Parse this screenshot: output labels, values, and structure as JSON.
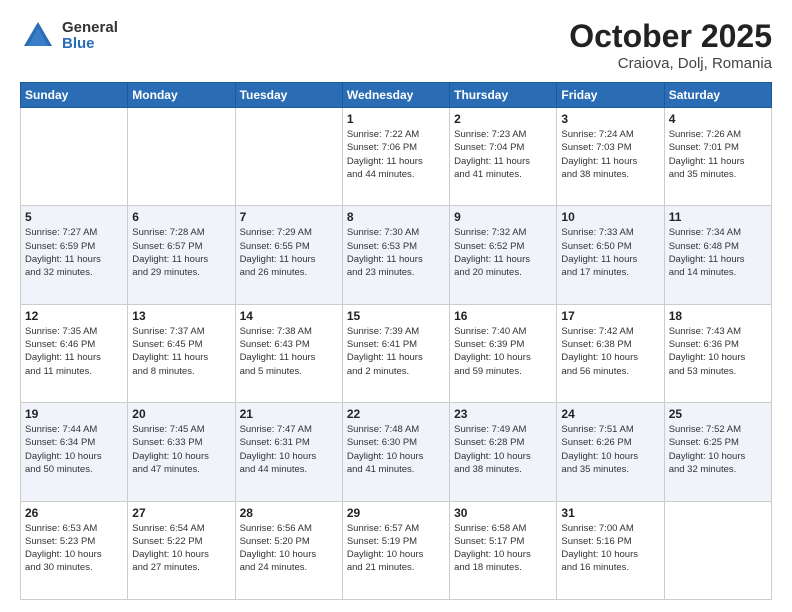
{
  "logo": {
    "general": "General",
    "blue": "Blue"
  },
  "title": "October 2025",
  "subtitle": "Craiova, Dolj, Romania",
  "days_of_week": [
    "Sunday",
    "Monday",
    "Tuesday",
    "Wednesday",
    "Thursday",
    "Friday",
    "Saturday"
  ],
  "weeks": [
    [
      {
        "day": "",
        "info": ""
      },
      {
        "day": "",
        "info": ""
      },
      {
        "day": "",
        "info": ""
      },
      {
        "day": "1",
        "info": "Sunrise: 7:22 AM\nSunset: 7:06 PM\nDaylight: 11 hours\nand 44 minutes."
      },
      {
        "day": "2",
        "info": "Sunrise: 7:23 AM\nSunset: 7:04 PM\nDaylight: 11 hours\nand 41 minutes."
      },
      {
        "day": "3",
        "info": "Sunrise: 7:24 AM\nSunset: 7:03 PM\nDaylight: 11 hours\nand 38 minutes."
      },
      {
        "day": "4",
        "info": "Sunrise: 7:26 AM\nSunset: 7:01 PM\nDaylight: 11 hours\nand 35 minutes."
      }
    ],
    [
      {
        "day": "5",
        "info": "Sunrise: 7:27 AM\nSunset: 6:59 PM\nDaylight: 11 hours\nand 32 minutes."
      },
      {
        "day": "6",
        "info": "Sunrise: 7:28 AM\nSunset: 6:57 PM\nDaylight: 11 hours\nand 29 minutes."
      },
      {
        "day": "7",
        "info": "Sunrise: 7:29 AM\nSunset: 6:55 PM\nDaylight: 11 hours\nand 26 minutes."
      },
      {
        "day": "8",
        "info": "Sunrise: 7:30 AM\nSunset: 6:53 PM\nDaylight: 11 hours\nand 23 minutes."
      },
      {
        "day": "9",
        "info": "Sunrise: 7:32 AM\nSunset: 6:52 PM\nDaylight: 11 hours\nand 20 minutes."
      },
      {
        "day": "10",
        "info": "Sunrise: 7:33 AM\nSunset: 6:50 PM\nDaylight: 11 hours\nand 17 minutes."
      },
      {
        "day": "11",
        "info": "Sunrise: 7:34 AM\nSunset: 6:48 PM\nDaylight: 11 hours\nand 14 minutes."
      }
    ],
    [
      {
        "day": "12",
        "info": "Sunrise: 7:35 AM\nSunset: 6:46 PM\nDaylight: 11 hours\nand 11 minutes."
      },
      {
        "day": "13",
        "info": "Sunrise: 7:37 AM\nSunset: 6:45 PM\nDaylight: 11 hours\nand 8 minutes."
      },
      {
        "day": "14",
        "info": "Sunrise: 7:38 AM\nSunset: 6:43 PM\nDaylight: 11 hours\nand 5 minutes."
      },
      {
        "day": "15",
        "info": "Sunrise: 7:39 AM\nSunset: 6:41 PM\nDaylight: 11 hours\nand 2 minutes."
      },
      {
        "day": "16",
        "info": "Sunrise: 7:40 AM\nSunset: 6:39 PM\nDaylight: 10 hours\nand 59 minutes."
      },
      {
        "day": "17",
        "info": "Sunrise: 7:42 AM\nSunset: 6:38 PM\nDaylight: 10 hours\nand 56 minutes."
      },
      {
        "day": "18",
        "info": "Sunrise: 7:43 AM\nSunset: 6:36 PM\nDaylight: 10 hours\nand 53 minutes."
      }
    ],
    [
      {
        "day": "19",
        "info": "Sunrise: 7:44 AM\nSunset: 6:34 PM\nDaylight: 10 hours\nand 50 minutes."
      },
      {
        "day": "20",
        "info": "Sunrise: 7:45 AM\nSunset: 6:33 PM\nDaylight: 10 hours\nand 47 minutes."
      },
      {
        "day": "21",
        "info": "Sunrise: 7:47 AM\nSunset: 6:31 PM\nDaylight: 10 hours\nand 44 minutes."
      },
      {
        "day": "22",
        "info": "Sunrise: 7:48 AM\nSunset: 6:30 PM\nDaylight: 10 hours\nand 41 minutes."
      },
      {
        "day": "23",
        "info": "Sunrise: 7:49 AM\nSunset: 6:28 PM\nDaylight: 10 hours\nand 38 minutes."
      },
      {
        "day": "24",
        "info": "Sunrise: 7:51 AM\nSunset: 6:26 PM\nDaylight: 10 hours\nand 35 minutes."
      },
      {
        "day": "25",
        "info": "Sunrise: 7:52 AM\nSunset: 6:25 PM\nDaylight: 10 hours\nand 32 minutes."
      }
    ],
    [
      {
        "day": "26",
        "info": "Sunrise: 6:53 AM\nSunset: 5:23 PM\nDaylight: 10 hours\nand 30 minutes."
      },
      {
        "day": "27",
        "info": "Sunrise: 6:54 AM\nSunset: 5:22 PM\nDaylight: 10 hours\nand 27 minutes."
      },
      {
        "day": "28",
        "info": "Sunrise: 6:56 AM\nSunset: 5:20 PM\nDaylight: 10 hours\nand 24 minutes."
      },
      {
        "day": "29",
        "info": "Sunrise: 6:57 AM\nSunset: 5:19 PM\nDaylight: 10 hours\nand 21 minutes."
      },
      {
        "day": "30",
        "info": "Sunrise: 6:58 AM\nSunset: 5:17 PM\nDaylight: 10 hours\nand 18 minutes."
      },
      {
        "day": "31",
        "info": "Sunrise: 7:00 AM\nSunset: 5:16 PM\nDaylight: 10 hours\nand 16 minutes."
      },
      {
        "day": "",
        "info": ""
      }
    ]
  ]
}
